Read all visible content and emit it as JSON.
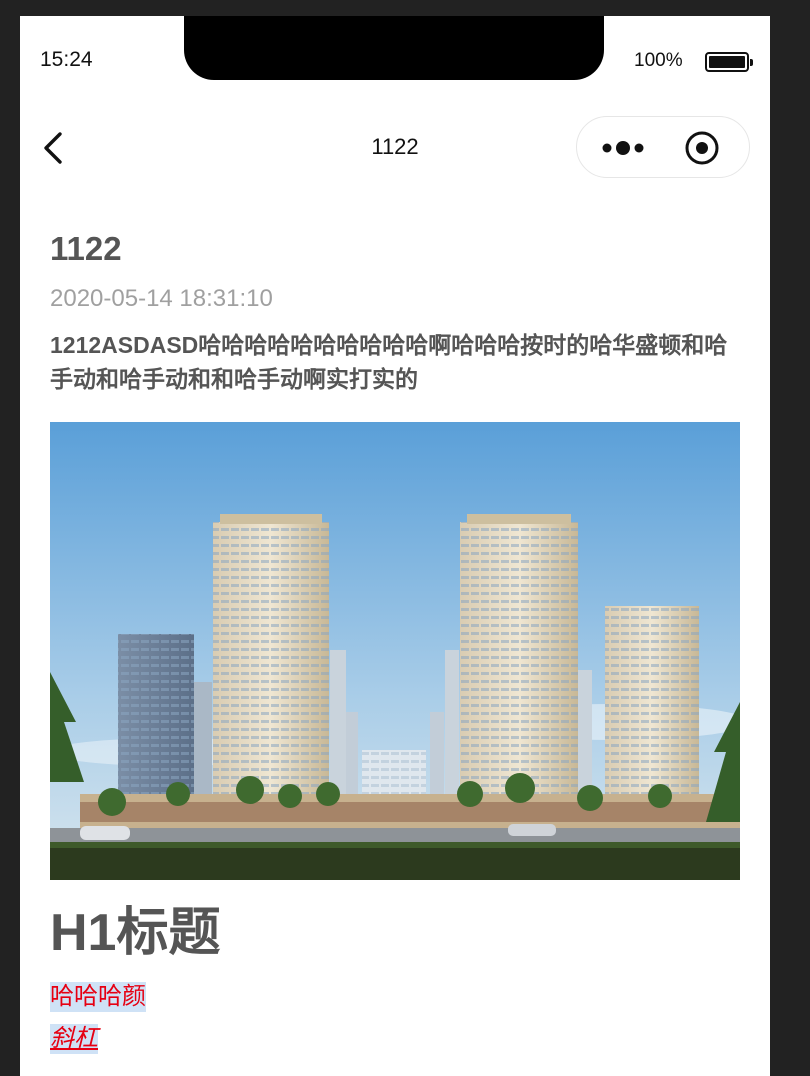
{
  "status_bar": {
    "time": "15:24",
    "battery_label": "100%"
  },
  "nav": {
    "title": "1122",
    "back_icon": "chevron-left-icon",
    "more_icon": "more-dots-icon",
    "close_icon": "target-circle-icon"
  },
  "article": {
    "title": "1122",
    "date": "2020-05-14 18:31:10",
    "summary": "1212ASDASD哈哈哈哈哈哈哈哈哈哈啊哈哈哈按时的哈华盛顿和哈手动和哈手动和和哈手动啊实打实的",
    "image_alt": "residential towers rendering",
    "heading": "H1标题",
    "red_text": "哈哈哈颜",
    "italic_text": "斜杠"
  },
  "colors": {
    "text_gray": "#555555",
    "date_gray": "#a0a0a0",
    "accent_red": "#e60012",
    "highlight_blue": "#cfe2f6"
  }
}
